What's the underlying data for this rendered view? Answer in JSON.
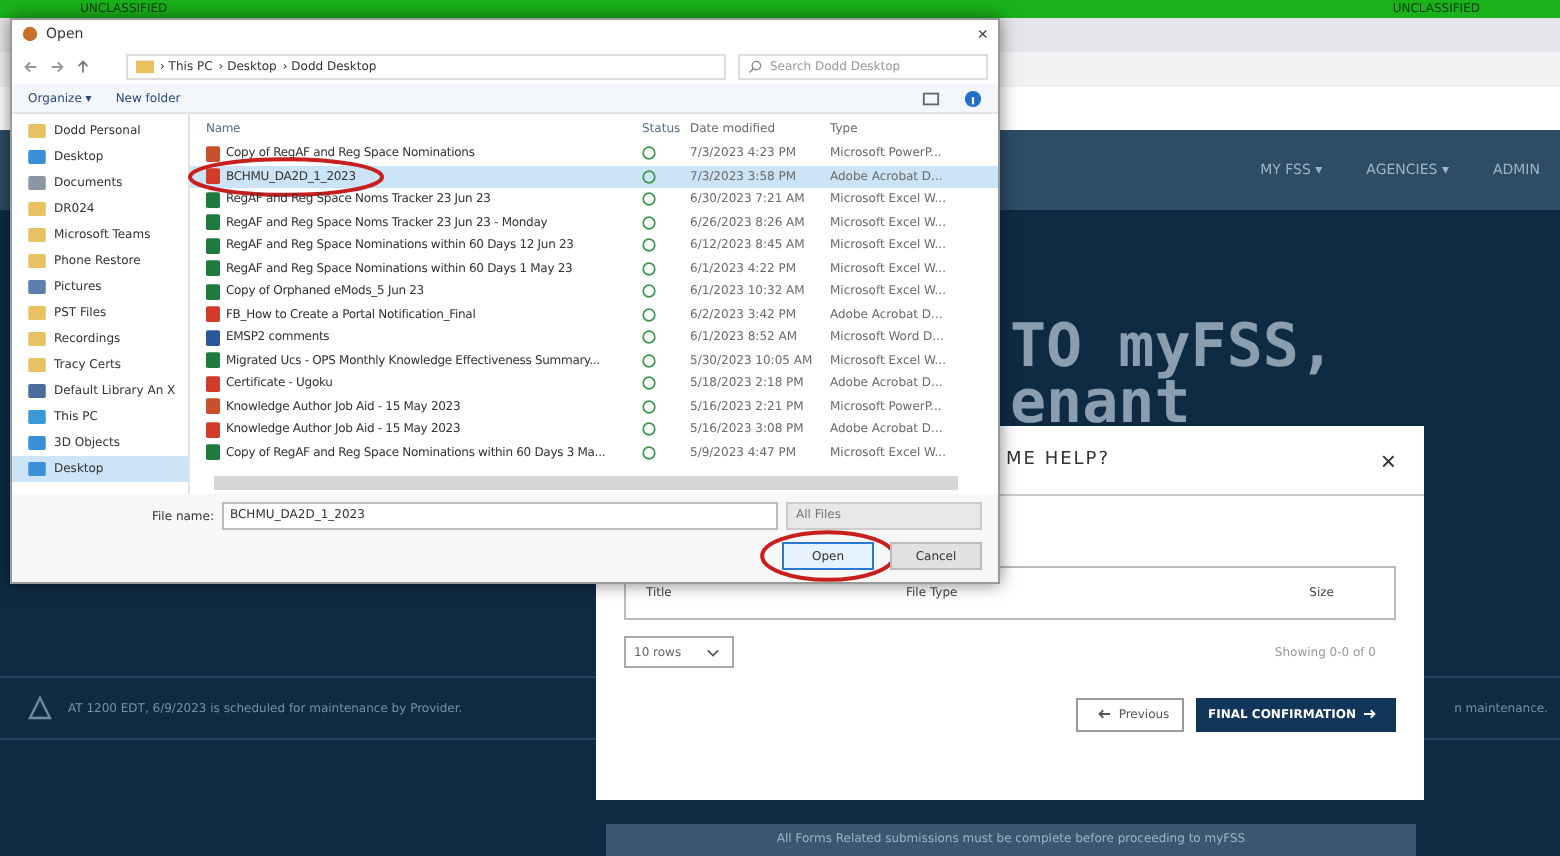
{
  "classification_bar": {
    "left": "UNCLASSIFIED",
    "right": "UNCLASSIFIED"
  },
  "web_page": {
    "nav_items": [
      "MY FSS ▾",
      "AGENCIES ▾",
      "ADMIN"
    ],
    "hero_lines": [
      "TO myFSS,",
      "enant"
    ],
    "alert": "AT 1200 EDT, 6/9/2023 is scheduled for maintenance by Provider.",
    "alert_tail": "n maintenance.",
    "banner": "All Forms Related submissions must be complete before proceeding to myFSS"
  },
  "help_modal": {
    "title": "ME HELP?",
    "close": "×",
    "columns": [
      "Title",
      "File Type",
      "Size"
    ],
    "rows_select": "10 rows",
    "showing": "Showing 0-0 of 0",
    "previous": "Previous",
    "confirm": "FINAL CONFIRMATION"
  },
  "open_dialog": {
    "title": "Open",
    "close": "×",
    "path": [
      "› This PC",
      "› Desktop",
      "› Dodd Desktop"
    ],
    "search_placeholder": "Search Dodd Desktop",
    "toolbar": [
      "Organize ▾",
      "New folder"
    ],
    "sidebar": [
      {
        "label": "Dodd Personal",
        "kind": "folder",
        "selected": false
      },
      {
        "label": "Desktop",
        "kind": "desktop",
        "selected": false
      },
      {
        "label": "Documents",
        "kind": "documents",
        "selected": false
      },
      {
        "label": "DR024",
        "kind": "folder",
        "selected": false
      },
      {
        "label": "Microsoft Teams",
        "kind": "folder",
        "selected": false
      },
      {
        "label": "Phone Restore",
        "kind": "folder",
        "selected": false
      },
      {
        "label": "Pictures",
        "kind": "pictures",
        "selected": false
      },
      {
        "label": "PST Files",
        "kind": "folder",
        "selected": false
      },
      {
        "label": "Recordings",
        "kind": "folder",
        "selected": false
      },
      {
        "label": "Tracy Certs",
        "kind": "folder",
        "selected": false
      },
      {
        "label": "Default Library An X",
        "kind": "user",
        "selected": false
      },
      {
        "label": "This PC",
        "kind": "pc",
        "selected": false
      },
      {
        "label": "3D Objects",
        "kind": "objects",
        "selected": false
      },
      {
        "label": "Desktop",
        "kind": "desktop",
        "selected": true
      }
    ],
    "columns": [
      "Name",
      "Status",
      "Date modified",
      "Type"
    ],
    "files": [
      {
        "name": "Copy of RegAF and Reg Space Nominations",
        "kind": "powerpoint",
        "date": "7/3/2023 4:23 PM",
        "type": "Microsoft PowerP...",
        "selected": false,
        "circled": false
      },
      {
        "name": "BCHMU_DA2D_1_2023",
        "kind": "pdf",
        "date": "7/3/2023 3:58 PM",
        "type": "Adobe Acrobat D...",
        "selected": true,
        "circled": true
      },
      {
        "name": "RegAF and Reg Space Noms Tracker 23 Jun 23",
        "kind": "excel",
        "date": "6/30/2023 7:21 AM",
        "type": "Microsoft Excel W...",
        "selected": false,
        "circled": false
      },
      {
        "name": "RegAF and Reg Space Noms Tracker 23 Jun 23 - Monday",
        "kind": "excel",
        "date": "6/26/2023 8:26 AM",
        "type": "Microsoft Excel W...",
        "selected": false,
        "circled": false
      },
      {
        "name": "RegAF and Reg Space Nominations within 60 Days 12 Jun 23",
        "kind": "excel",
        "date": "6/12/2023 8:45 AM",
        "type": "Microsoft Excel W...",
        "selected": false,
        "circled": false
      },
      {
        "name": "RegAF and Reg Space Nominations within 60 Days 1 May 23",
        "kind": "excel",
        "date": "6/1/2023 4:22 PM",
        "type": "Microsoft Excel W...",
        "selected": false,
        "circled": false
      },
      {
        "name": "Copy of Orphaned eMods_5 Jun 23",
        "kind": "excel",
        "date": "6/1/2023 10:32 AM",
        "type": "Microsoft Excel W...",
        "selected": false,
        "circled": false
      },
      {
        "name": "FB_How to Create a Portal Notification_Final",
        "kind": "pdf",
        "date": "6/2/2023 3:42 PM",
        "type": "Adobe Acrobat D...",
        "selected": false,
        "circled": false
      },
      {
        "name": "EMSP2 comments",
        "kind": "word",
        "date": "6/1/2023 8:52 AM",
        "type": "Microsoft Word D...",
        "selected": false,
        "circled": false
      },
      {
        "name": "Migrated Ucs - OPS Monthly Knowledge Effectiveness Summary...",
        "kind": "excel",
        "date": "5/30/2023 10:05 AM",
        "type": "Microsoft Excel W...",
        "selected": false,
        "circled": false
      },
      {
        "name": "Certificate - Ugoku",
        "kind": "pdf",
        "date": "5/18/2023 2:18 PM",
        "type": "Adobe Acrobat D...",
        "selected": false,
        "circled": false
      },
      {
        "name": "Knowledge Author Job Aid - 15 May 2023",
        "kind": "powerpoint",
        "date": "5/16/2023 2:21 PM",
        "type": "Microsoft PowerP...",
        "selected": false,
        "circled": false
      },
      {
        "name": "Knowledge Author Job Aid - 15 May 2023",
        "kind": "pdf",
        "date": "5/16/2023 3:08 PM",
        "type": "Adobe Acrobat D...",
        "selected": false,
        "circled": false
      },
      {
        "name": "Copy of RegAF and Reg Space Nominations within 60 Days 3 Ma...",
        "kind": "excel",
        "date": "5/9/2023 4:47 PM",
        "type": "Microsoft Excel W...",
        "selected": false,
        "circled": false
      }
    ],
    "file_name_label": "File name:",
    "file_name": "BCHMU_DA2D_1_2023",
    "file_type": "All Files",
    "buttons": [
      {
        "label": "Open",
        "kind": "primary",
        "circled": true
      },
      {
        "label": "Cancel",
        "kind": "secondary",
        "circled": false
      }
    ]
  }
}
